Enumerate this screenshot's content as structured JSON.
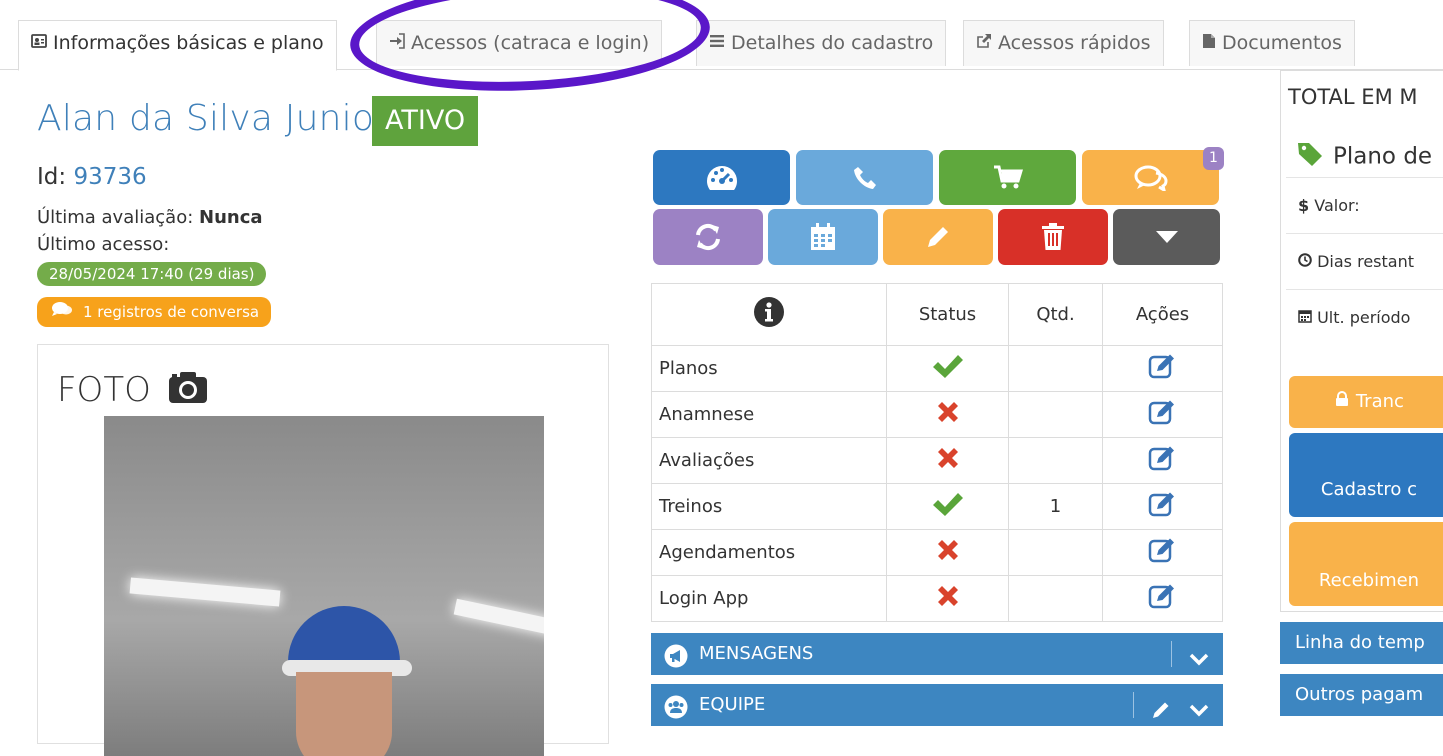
{
  "tabs": [
    {
      "label": "Informações básicas e plano",
      "icon": "id-card-icon",
      "active": true
    },
    {
      "label": "Acessos (catraca e login)",
      "icon": "sign-in-icon",
      "active": false
    },
    {
      "label": "Detalhes do cadastro",
      "icon": "list-icon",
      "active": false
    },
    {
      "label": "Acessos rápidos",
      "icon": "external-link-icon",
      "active": false
    },
    {
      "label": "Documentos",
      "icon": "file-icon",
      "active": false
    }
  ],
  "profile": {
    "name": "Alan da Silva Junior",
    "status": "ATIVO",
    "id_label": "Id:",
    "id_value": "93736",
    "last_eval_label": "Última avaliação:",
    "last_eval_value": "Nunca",
    "last_access_label": "Último acesso:",
    "last_access_value": "28/05/2024 17:40 (29 dias)",
    "conversations": "1 registros de conversa"
  },
  "photo": {
    "title": "FOTO"
  },
  "actions": {
    "message_badge": "1"
  },
  "checklist": {
    "headers": {
      "status": "Status",
      "qtd": "Qtd.",
      "acoes": "Ações"
    },
    "rows": [
      {
        "label": "Planos",
        "ok": true,
        "qtd": ""
      },
      {
        "label": "Anamnese",
        "ok": false,
        "qtd": ""
      },
      {
        "label": "Avaliações",
        "ok": false,
        "qtd": ""
      },
      {
        "label": "Treinos",
        "ok": true,
        "qtd": "1"
      },
      {
        "label": "Agendamentos",
        "ok": false,
        "qtd": ""
      },
      {
        "label": "Login App",
        "ok": false,
        "qtd": ""
      }
    ]
  },
  "accordions": {
    "messages": "MENSAGENS",
    "team": "EQUIPE"
  },
  "right": {
    "heading": "TOTAL EM M",
    "plan": "Plano de",
    "valor": "Valor:",
    "dias": "Dias restant",
    "periodo": "Ult. período",
    "tranc": "Tranc",
    "cadastro": "Cadastro c",
    "receb": "Recebimen",
    "linha": "Linha do temp",
    "outros": "Outros pagam"
  },
  "colors": {
    "accent_blue": "#3f80b9",
    "status_green": "#5fa33d",
    "annotation_purple": "#5a17c9",
    "ok_green": "#5aa53a",
    "fail_red": "#d9432c"
  }
}
